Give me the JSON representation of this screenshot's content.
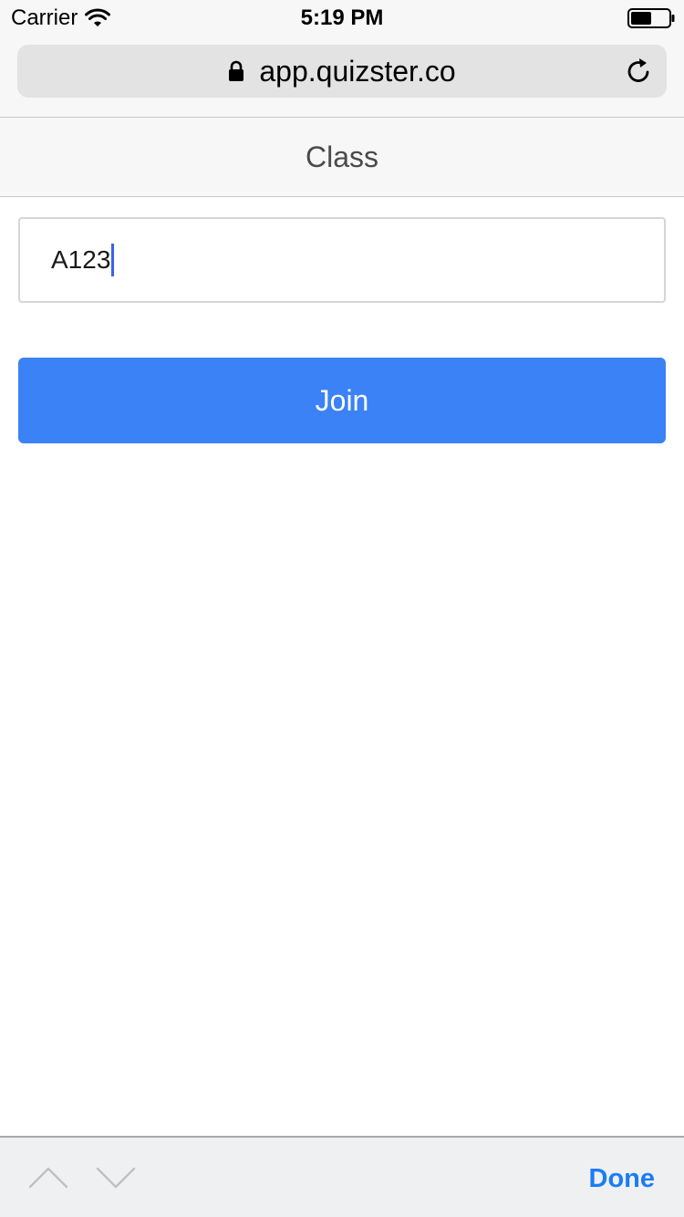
{
  "status_bar": {
    "carrier": "Carrier",
    "time": "5:19 PM"
  },
  "browser": {
    "url": "app.quizster.co"
  },
  "page": {
    "title": "Class"
  },
  "form": {
    "class_code_value": "A123",
    "join_label": "Join"
  },
  "keyboard_accessory": {
    "done_label": "Done"
  },
  "icons": {
    "wifi": "wifi-icon",
    "battery": "battery-icon",
    "lock": "lock-icon",
    "reload": "reload-icon",
    "previous": "chevron-up-icon",
    "next": "chevron-down-icon"
  },
  "colors": {
    "accent": "#3a82f5",
    "done_text": "#1a7cf5",
    "cursor": "#3a63e6"
  }
}
